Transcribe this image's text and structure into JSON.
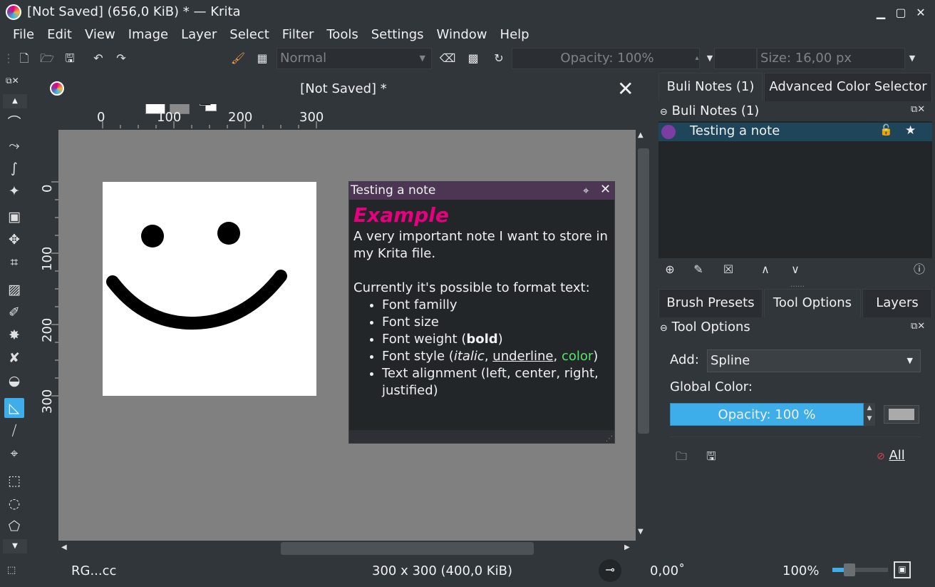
{
  "window": {
    "title": "[Not Saved] (656,0 KiB) * — Krita"
  },
  "menu": [
    "File",
    "Edit",
    "View",
    "Image",
    "Layer",
    "Select",
    "Filter",
    "Tools",
    "Settings",
    "Window",
    "Help"
  ],
  "toolbar": {
    "blend_mode": "Normal",
    "opacity": "Opacity: 100%",
    "size": "Size: 16,00 px"
  },
  "document": {
    "tab_title": "[Not Saved]  *",
    "ruler_h": [
      "0",
      "100",
      "200",
      "300"
    ],
    "ruler_v": [
      "0",
      "100",
      "200",
      "300"
    ]
  },
  "note_popup": {
    "title": "Testing a note",
    "heading": "Example",
    "paragraph1": "A very important note I want to store in my Krita file.",
    "paragraph2": "Currently it's possible to format text:",
    "list": {
      "item1": "Font familly",
      "item2": "Font size",
      "item3_pre": "Font weight (",
      "item3_bold": "bold",
      "item3_post": ")",
      "item4_pre": "Font style (",
      "item4_italic": "italic",
      "item4_sep1": ", ",
      "item4_underline": "underline",
      "item4_sep2": ", ",
      "item4_color": "color",
      "item4_post": ")",
      "item5": "Text alignment (left, center, right, justified)"
    },
    "colors": {
      "header": "#4c3654",
      "heading": "#e6007e",
      "color_word": "#55e56b"
    }
  },
  "right_dock": {
    "tabs_top": [
      "Buli Notes (1)",
      "Advanced Color Selector"
    ],
    "notes_header": "Buli Notes (1)",
    "note_item": "Testing a note",
    "note_item_color": "#7d3ea1",
    "tabs_bottom": [
      "Brush Presets",
      "Tool Options",
      "Layers"
    ],
    "tool_options_header": "Tool Options",
    "add_label": "Add:",
    "add_value": "Spline",
    "global_color_label": "Global Color:",
    "opacity_value": "Opacity: 100 %",
    "all_button": "All"
  },
  "statusbar": {
    "color_model": "RG...cc",
    "image_size": "300 x 300 (400,0 KiB)",
    "rotation": "0,00˚",
    "zoom": "100%"
  },
  "colors": {
    "accent": "#3daee9",
    "background": "#31363b",
    "canvas_bg": "#808080"
  }
}
